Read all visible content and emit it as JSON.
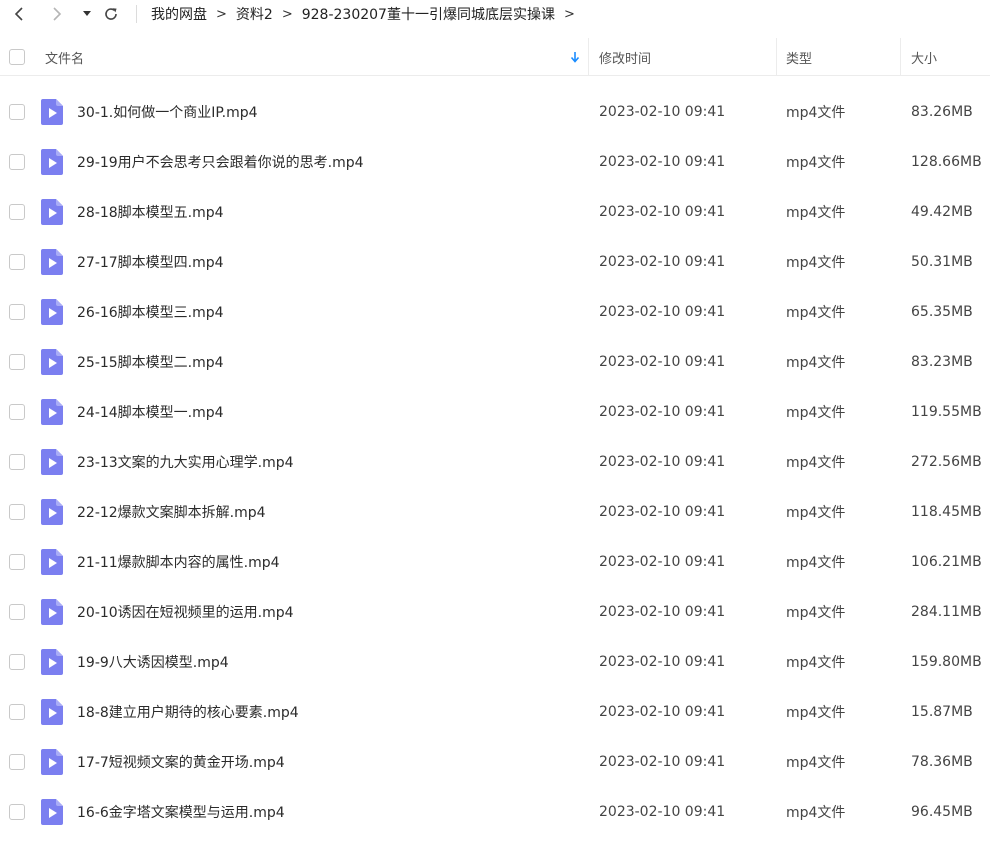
{
  "nav": {
    "breadcrumbs": [
      "我的网盘",
      "资料2",
      "928-230207董十一引爆同城底层实操课"
    ],
    "separator": ">"
  },
  "header": {
    "name": "文件名",
    "mtime": "修改时间",
    "type": "类型",
    "size": "大小"
  },
  "colors": {
    "accent": "#1a8cff",
    "file_icon": "#7b7ff0"
  },
  "files": [
    {
      "name": "30-1.如何做一个商业IP.mp4",
      "mtime": "2023-02-10 09:41",
      "type": "mp4文件",
      "size": "83.26MB"
    },
    {
      "name": "29-19用户不会思考只会跟着你说的思考.mp4",
      "mtime": "2023-02-10 09:41",
      "type": "mp4文件",
      "size": "128.66MB"
    },
    {
      "name": "28-18脚本模型五.mp4",
      "mtime": "2023-02-10 09:41",
      "type": "mp4文件",
      "size": "49.42MB"
    },
    {
      "name": "27-17脚本模型四.mp4",
      "mtime": "2023-02-10 09:41",
      "type": "mp4文件",
      "size": "50.31MB"
    },
    {
      "name": "26-16脚本模型三.mp4",
      "mtime": "2023-02-10 09:41",
      "type": "mp4文件",
      "size": "65.35MB"
    },
    {
      "name": "25-15脚本模型二.mp4",
      "mtime": "2023-02-10 09:41",
      "type": "mp4文件",
      "size": "83.23MB"
    },
    {
      "name": "24-14脚本模型一.mp4",
      "mtime": "2023-02-10 09:41",
      "type": "mp4文件",
      "size": "119.55MB"
    },
    {
      "name": "23-13文案的九大实用心理学.mp4",
      "mtime": "2023-02-10 09:41",
      "type": "mp4文件",
      "size": "272.56MB"
    },
    {
      "name": "22-12爆款文案脚本拆解.mp4",
      "mtime": "2023-02-10 09:41",
      "type": "mp4文件",
      "size": "118.45MB"
    },
    {
      "name": "21-11爆款脚本内容的属性.mp4",
      "mtime": "2023-02-10 09:41",
      "type": "mp4文件",
      "size": "106.21MB"
    },
    {
      "name": "20-10诱因在短视频里的运用.mp4",
      "mtime": "2023-02-10 09:41",
      "type": "mp4文件",
      "size": "284.11MB"
    },
    {
      "name": "19-9八大诱因模型.mp4",
      "mtime": "2023-02-10 09:41",
      "type": "mp4文件",
      "size": "159.80MB"
    },
    {
      "name": "18-8建立用户期待的核心要素.mp4",
      "mtime": "2023-02-10 09:41",
      "type": "mp4文件",
      "size": "15.87MB"
    },
    {
      "name": "17-7短视频文案的黄金开场.mp4",
      "mtime": "2023-02-10 09:41",
      "type": "mp4文件",
      "size": "78.36MB"
    },
    {
      "name": "16-6金字塔文案模型与运用.mp4",
      "mtime": "2023-02-10 09:41",
      "type": "mp4文件",
      "size": "96.45MB"
    }
  ]
}
